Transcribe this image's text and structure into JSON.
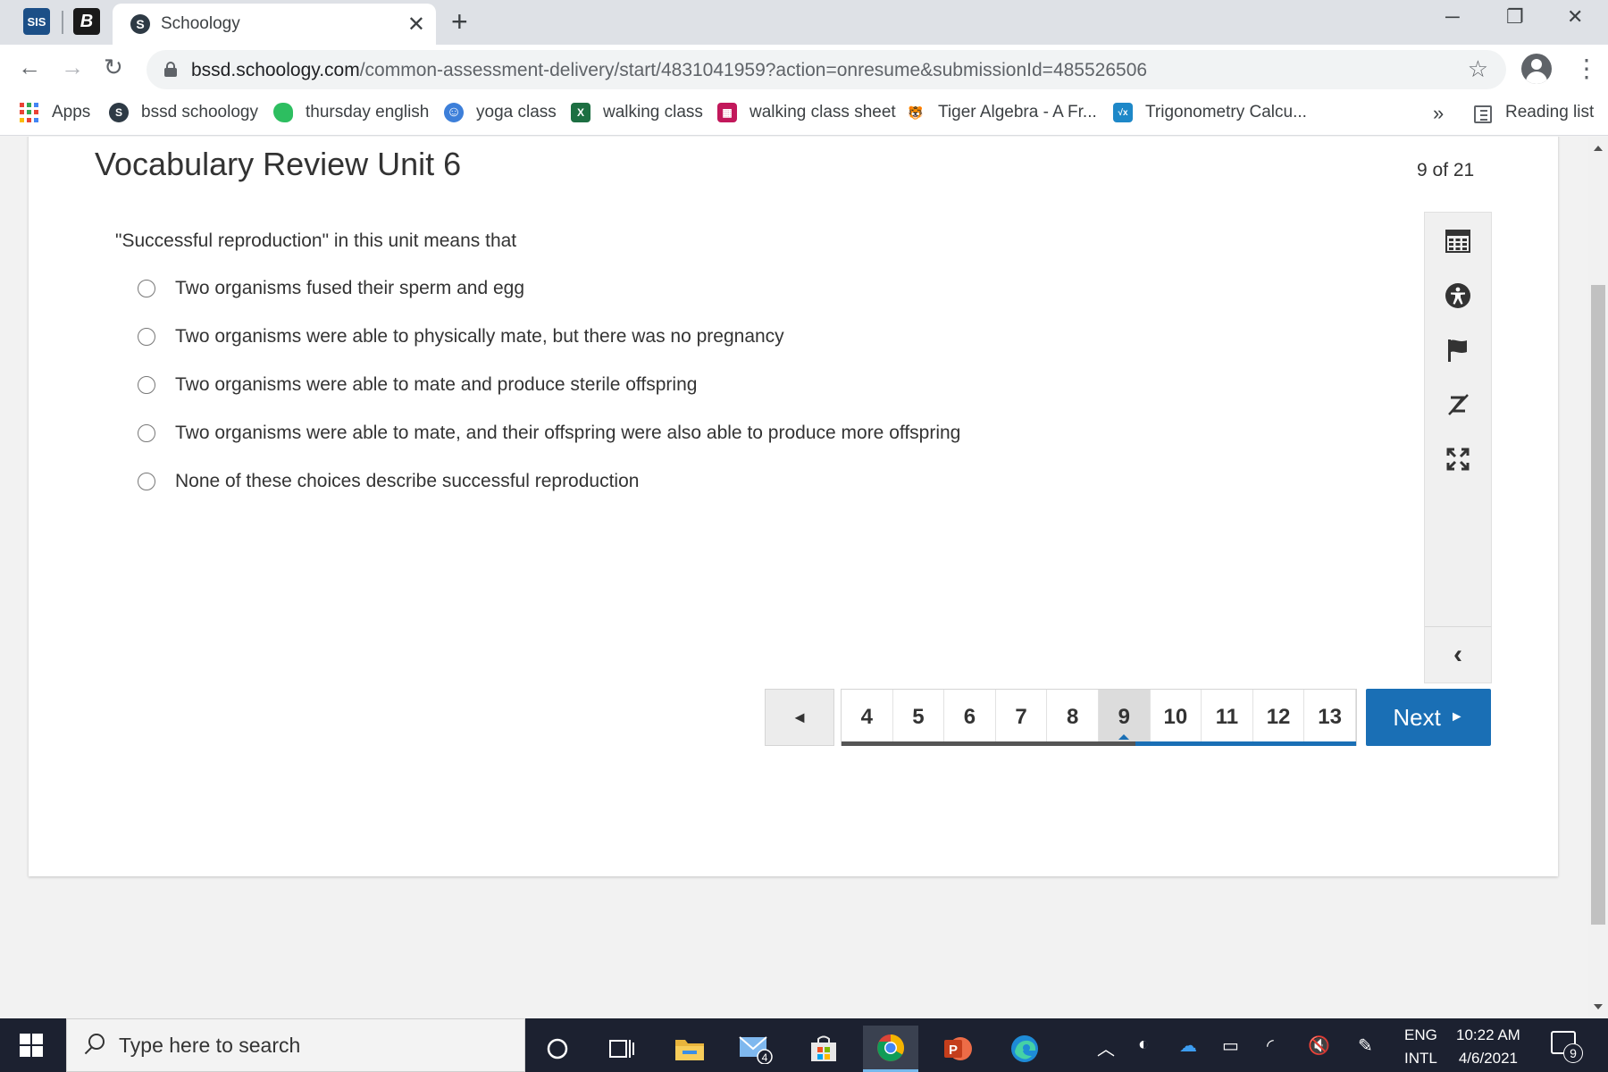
{
  "browser": {
    "pinned_tabs": [
      "SIS",
      "B"
    ],
    "active_tab": {
      "favicon": "S",
      "title": "Schoology"
    },
    "url_host": "bssd.schoology.com",
    "url_path": "/common-assessment-delivery/start/4831041959?action=onresume&submissionId=485526506",
    "bookmarks": [
      {
        "label": "Apps",
        "icon": "apps-grid-icon"
      },
      {
        "label": "bssd schoology",
        "icon": "schoology-icon",
        "glyph": "S",
        "color": "#2e3a45"
      },
      {
        "label": "thursday english",
        "icon": "evernote-icon",
        "glyph": "",
        "color": "#2dbe60"
      },
      {
        "label": "yoga class",
        "icon": "smiley-icon",
        "glyph": "☺",
        "color": "#3d7fd9"
      },
      {
        "label": "walking class",
        "icon": "excel-icon",
        "glyph": "X",
        "color": "#1d6f42"
      },
      {
        "label": "walking class sheet",
        "icon": "forms-icon",
        "glyph": "▦",
        "color": "#c2185b"
      },
      {
        "label": "Tiger Algebra - A Fr...",
        "icon": "tiger-icon",
        "glyph": "🐯",
        "color": "#ffffff"
      },
      {
        "label": "Trigonometry Calcu...",
        "icon": "calculator-icon",
        "glyph": "√x",
        "color": "#1e88c8"
      }
    ],
    "more": "»",
    "reading_list": "Reading list"
  },
  "assessment": {
    "title": "Vocabulary Review Unit 6",
    "counter": "9 of 21",
    "question": "\"Successful reproduction\" in this unit means that",
    "choices": [
      "Two organisms fused their sperm and egg",
      "Two organisms were able to physically mate, but there was no pregnancy",
      "Two organisms were able to mate and produce sterile offspring",
      "Two organisms were able to mate, and their offspring were also able to produce more offspring",
      "None of these choices describe successful reproduction"
    ],
    "tools": [
      "calculator-icon",
      "accessibility-icon",
      "flag-icon",
      "eliminate-answer-icon",
      "fullscreen-icon"
    ],
    "pager": {
      "prev": "◄",
      "pages": [
        "4",
        "5",
        "6",
        "7",
        "8",
        "9",
        "10",
        "11",
        "12",
        "13"
      ],
      "current": "9",
      "progress_fraction": 0.4286
    },
    "next_label": "Next",
    "next_arrow": "►",
    "accent_color": "#1a6fb5"
  },
  "taskbar": {
    "search_placeholder": "Type here to search",
    "mail_badge": "4",
    "lang_top": "ENG",
    "lang_bottom": "INTL",
    "time": "10:22 AM",
    "date": "4/6/2021",
    "notifications": "9"
  }
}
